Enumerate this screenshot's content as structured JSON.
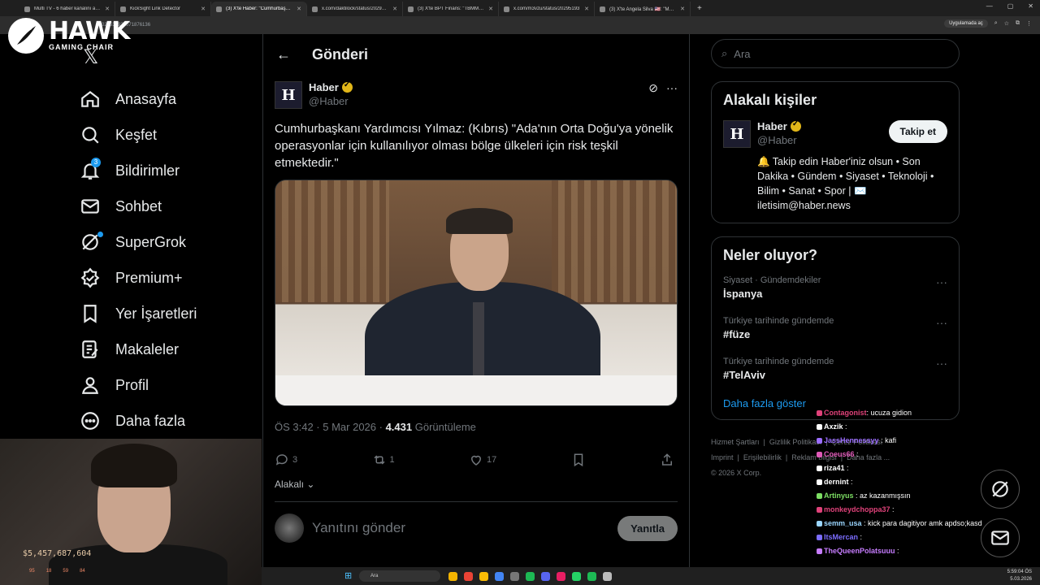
{
  "browser": {
    "tabs": [
      {
        "label": "Multi TV - 6 haber kanalını aynı",
        "active": false
      },
      {
        "label": "KickSight Link Detector",
        "active": false
      },
      {
        "label": "(3) X'te Haber: \"Cumhurbaşkanı",
        "active": true
      },
      {
        "label": "x.com/daktilock/status/2029533",
        "active": false
      },
      {
        "label": "(3) X'te BPT Finans: \"TBMM Pla",
        "active": false
      },
      {
        "label": "x.com/m3vzu/status/20295193",
        "active": false
      },
      {
        "label": "(3) X'te Angela Silva 🇺🇸: \"Muers",
        "active": false
      }
    ],
    "new_tab": "+",
    "url": "/2029537925071876136",
    "app_button": "Uygulamada aç",
    "window_controls": [
      "—",
      "▢",
      "✕"
    ]
  },
  "logo": {
    "title": "HAWK",
    "subtitle": "GAMING CHAIR"
  },
  "nav": {
    "items": [
      {
        "label": "Anasayfa",
        "icon": "home-icon"
      },
      {
        "label": "Keşfet",
        "icon": "search-icon"
      },
      {
        "label": "Bildirimler",
        "icon": "bell-icon",
        "badge": "3"
      },
      {
        "label": "Sohbet",
        "icon": "mail-icon"
      },
      {
        "label": "SuperGrok",
        "icon": "grok-icon"
      },
      {
        "label": "Premium+",
        "icon": "premium-icon"
      },
      {
        "label": "Yer İşaretleri",
        "icon": "bookmark-icon"
      },
      {
        "label": "Makaleler",
        "icon": "article-icon"
      },
      {
        "label": "Profil",
        "icon": "profile-icon"
      },
      {
        "label": "Daha fazla",
        "icon": "more-icon"
      }
    ]
  },
  "webcam": {
    "overlay_text": "$5,457,687,604",
    "mini": [
      "95",
      "18",
      "59",
      "84"
    ]
  },
  "post_page": {
    "header_title": "Gönderi",
    "author_name": "Haber",
    "author_handle": "@Haber",
    "text": "Cumhurbaşkanı Yardımcısı Yılmaz: (Kıbrıs) \"Ada'nın Orta Doğu'ya yönelik operasyonlar için kullanılıyor olması bölge ülkeleri için risk teşkil etmektedir.\"",
    "time": "ÖS 3:42 · 5 Mar 2026 · ",
    "views": "4.431",
    "views_label": " Görüntüleme",
    "replies": "3",
    "reposts": "1",
    "likes": "17",
    "related_label": "Alakalı",
    "reply_placeholder": "Yanıtını gönder",
    "reply_button": "Yanıtla"
  },
  "sidebar": {
    "search_placeholder": "Ara",
    "relevant_title": "Alakalı kişiler",
    "person_name": "Haber",
    "person_handle": "@Haber",
    "follow_label": "Takip et",
    "bio": "🔔 Takip edin Haber'iniz olsun • Son Dakika • Gündem • Siyaset • Teknoloji • Bilim • Sanat • Spor | ✉️ iletisim@haber.news",
    "trends_title": "Neler oluyor?",
    "trends": [
      {
        "context": "Siyaset · Gündemdekiler",
        "topic": "İspanya"
      },
      {
        "context": "Türkiye tarihinde gündemde",
        "topic": "#füze"
      },
      {
        "context": "Türkiye tarihinde gündemde",
        "topic": "#TelAviv"
      }
    ],
    "show_more": "Daha fazla göster",
    "footer": [
      "Hizmet Şartları",
      "Gizlilik Politikası",
      "Çerez Politikası",
      "Imprint",
      "Erişilebilirlik",
      "Reklam bilgisi",
      "Daha fazla ...",
      "© 2026 X Corp."
    ]
  },
  "chat": {
    "lines": [
      {
        "user": "Contagonist",
        "msg": ": ucuza gidion",
        "color": "#e0427a"
      },
      {
        "user": "Axzik",
        "msg": " :",
        "color": "#ffffff"
      },
      {
        "user": "JassHennessyy",
        "msg": " : kafi",
        "color": "#9b6dff"
      },
      {
        "user": "Coeus66",
        "msg": " :",
        "color": "#e05ab8"
      },
      {
        "user": "riza41",
        "msg": " :",
        "color": "#ffffff"
      },
      {
        "user": "dernint",
        "msg": " :",
        "color": "#ffffff"
      },
      {
        "user": "Artinyus",
        "msg": " : az kazanmışsın",
        "color": "#7ddf64"
      },
      {
        "user": "monkeydchoppa37",
        "msg": " :",
        "color": "#e0427a"
      },
      {
        "user": "semm_usa",
        "msg": " : kick para dagitiyor amk apdso;kasd",
        "color": "#9bd6ff"
      },
      {
        "user": "ItsMercan",
        "msg": " :",
        "color": "#7c6dff"
      },
      {
        "user": "TheQueenPolatsuuu",
        "msg": " :",
        "color": "#c77dff"
      }
    ]
  },
  "taskbar": {
    "search": "Ara",
    "time": "5:59:04 ÖS",
    "date": "5.03.2026"
  }
}
